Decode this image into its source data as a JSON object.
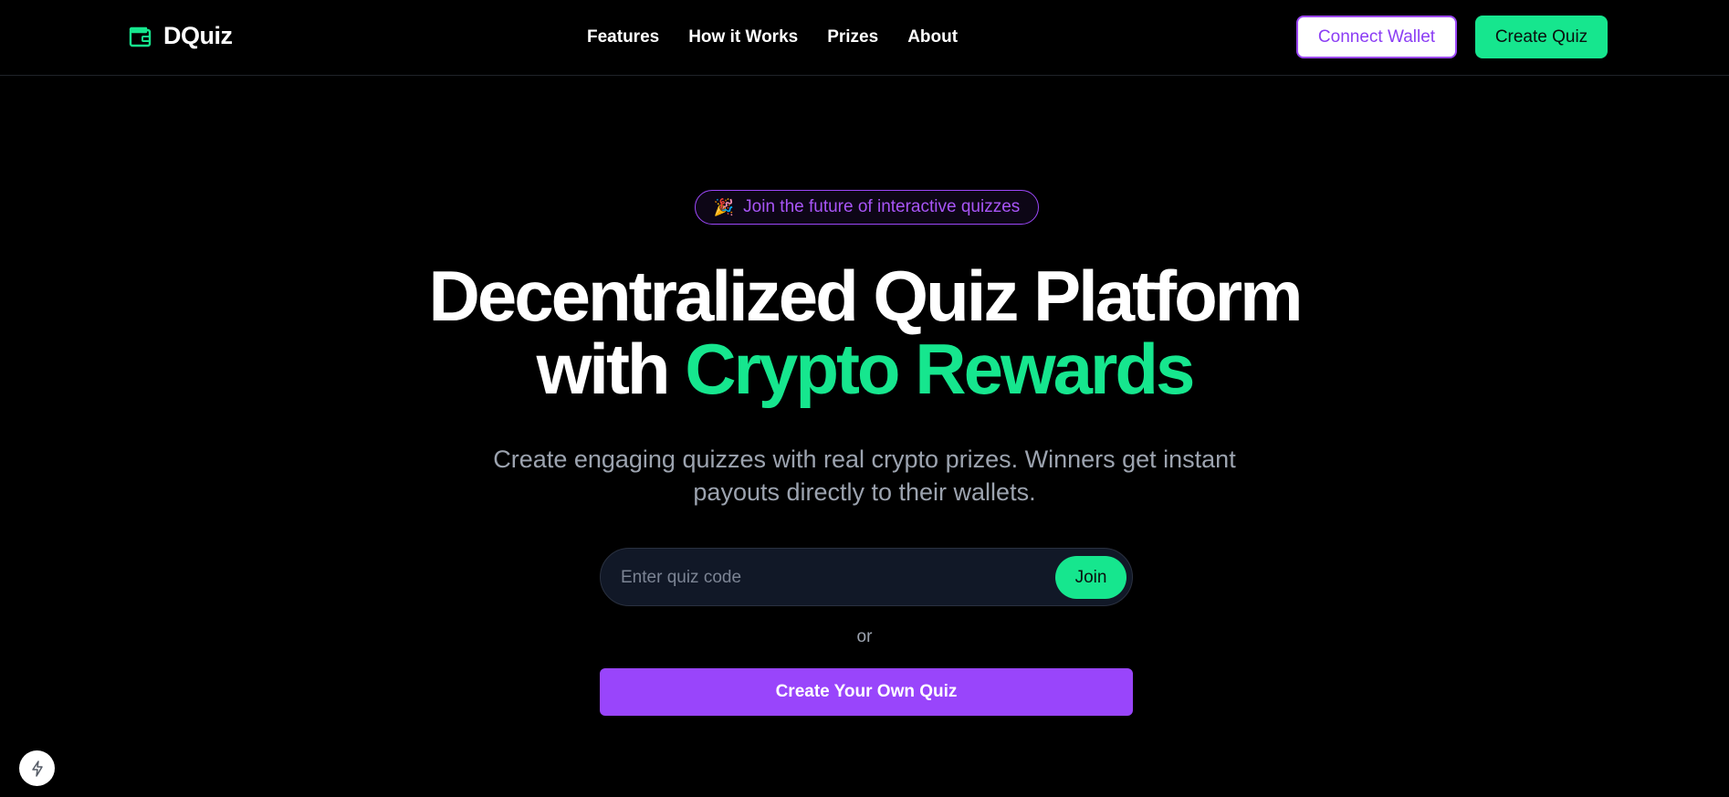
{
  "brand": {
    "name": "DQuiz",
    "icon": "wallet-icon",
    "accent_color": "#16e68e"
  },
  "nav": {
    "links": [
      "Features",
      "How it Works",
      "Prizes",
      "About"
    ],
    "connect_wallet_label": "Connect Wallet",
    "create_quiz_label": "Create Quiz"
  },
  "hero": {
    "badge_icon": "🎉",
    "badge_text": "Join the future of interactive quizzes",
    "headline_line1": "Decentralized Quiz Platform",
    "headline_line2_prefix": "with",
    "headline_line2_accent": "Crypto Rewards",
    "subtitle": "Create engaging quizzes with real crypto prizes. Winners get instant payouts directly to their wallets."
  },
  "join": {
    "placeholder": "Enter quiz code",
    "value": "",
    "button_label": "Join"
  },
  "divider_text": "or",
  "create_own_label": "Create Your Own Quiz",
  "floating": {
    "icon": "lightning-bolt-icon"
  },
  "colors": {
    "green": "#16e68e",
    "purple": "#9945fb",
    "background": "#000000"
  }
}
